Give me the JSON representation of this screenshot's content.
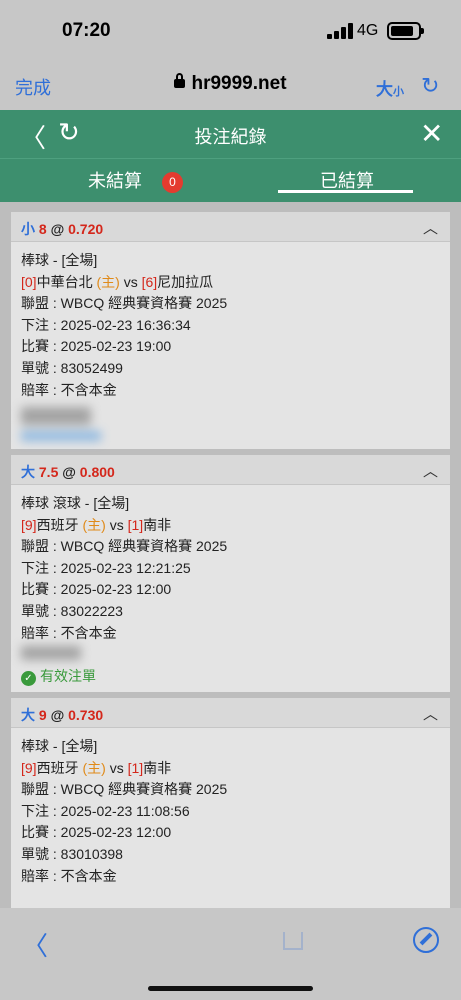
{
  "status_bar": {
    "time": "07:20",
    "network": "4G"
  },
  "browser": {
    "done_label": "完成",
    "url": "hr9999.net",
    "text_size_label": "大",
    "text_size_small": "小"
  },
  "header": {
    "title": "投注紀錄"
  },
  "tabs": {
    "unsettled_label": "未結算",
    "unsettled_count": "0",
    "settled_label": "已結算",
    "active": "settled"
  },
  "bets": [
    {
      "side": "小",
      "line": "8",
      "at": "@",
      "odds": "0.720",
      "sport": "棒球 - [全場]",
      "home_num": "[0]",
      "home_team": "中華台北",
      "home_tag": "(主)",
      "vs": "vs",
      "away_num": "[6]",
      "away_team": "尼加拉瓜",
      "league": "聯盟 : WBCQ 經典賽資格賽 2025",
      "bet_time": "下注 : 2025-02-23 16:36:34",
      "match_time": "比賽 : 2025-02-23 19:00",
      "ticket": "單號 : 83052499",
      "odds_type": "賠率 : 不含本金"
    },
    {
      "side": "大",
      "line": "7.5",
      "at": "@",
      "odds": "0.800",
      "sport": "棒球 滾球 - [全場]",
      "home_num": "[9]",
      "home_team": "西班牙",
      "home_tag": "(主)",
      "vs": "vs",
      "away_num": "[1]",
      "away_team": "南非",
      "league": "聯盟 : WBCQ 經典賽資格賽 2025",
      "bet_time": "下注 : 2025-02-23 12:21:25",
      "match_time": "比賽 : 2025-02-23 12:00",
      "ticket": "單號 : 83022223",
      "odds_type": "賠率 : 不含本金",
      "status": "有效注單"
    },
    {
      "side": "大",
      "line": "9",
      "at": "@",
      "odds": "0.730",
      "sport": "棒球 - [全場]",
      "home_num": "[9]",
      "home_team": "西班牙",
      "home_tag": "(主)",
      "vs": "vs",
      "away_num": "[1]",
      "away_team": "南非",
      "league": "聯盟 : WBCQ 經典賽資格賽 2025",
      "bet_time": "下注 : 2025-02-23 11:08:56",
      "match_time": "比賽 : 2025-02-23 12:00",
      "ticket": "單號 : 83010398",
      "odds_type": "賠率 : 不含本金"
    }
  ],
  "colors": {
    "header_green": "#3d8f6e",
    "badge_red": "#e43b2f",
    "link_blue": "#2f6fd8",
    "odds_red": "#d4271b",
    "home_orange": "#e08a19"
  }
}
